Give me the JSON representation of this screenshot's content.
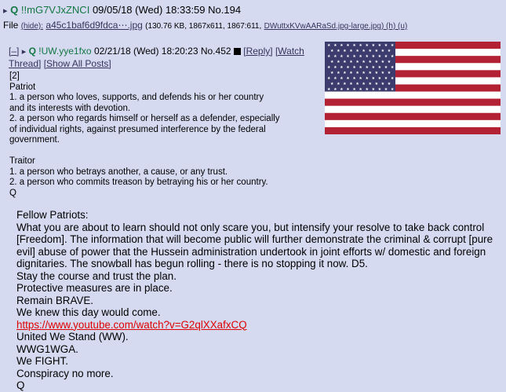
{
  "post": {
    "prefix": "▸",
    "name": "Q",
    "trip": "!!mG7VJxZNCI",
    "date": "09/05/18 (Wed) 18:33:59",
    "number": "No.194",
    "file_label": "File",
    "file_hide": "(hide):",
    "file_name": "a45c1baf6d9fdca⋯.jpg",
    "file_info": "(130.76 KB, 1867x611, 1867:611,",
    "file_source": "DWuttxKVwAARaSd.jpg-large.jpg",
    "file_links": ") (h) (u)"
  },
  "quoted": {
    "controls": "[–]",
    "name": "Q",
    "trip": "!UW.yye1fxo",
    "date": "02/21/18 (Wed) 18:20:23",
    "number": "No.452",
    "reply": "[Reply]",
    "watch": "[Watch",
    "thread": "Thread]",
    "show_all": "[Show All Posts]",
    "lines": [
      "[2]",
      "Patriot",
      "1. a person who loves, supports, and defends his or her country",
      "and its interests with devotion.",
      "2. a person who regards himself or herself as a defender, especially",
      "of individual rights, against presumed interference by the federal",
      "government.",
      "",
      "Traitor",
      "1. a person who betrays another, a cause, or any trust.",
      "2. a person who commits treason by betraying his or her country.",
      "Q"
    ]
  },
  "message": {
    "lines": [
      "Fellow Patriots:",
      "What you are about to learn should not only scare you, but intensify your resolve to take back control",
      "[Freedom]. The information that will become public will further demonstrate the criminal & corrupt [pure",
      "evil] abuse of power that the Hussein administration undertook in joint efforts w/ domestic and foreign",
      "dignitaries. The snowball has begun rolling - there is no stopping it now. D5.",
      "Stay the course and trust the plan.",
      "Protective measures are in place.",
      "Remain BRAVE.",
      "We knew this day would come."
    ],
    "link": "https://www.youtube.com/watch?v=G2qlXXafxCQ",
    "closing": [
      "United We Stand (WW).",
      "WWG1WGA.",
      "We FIGHT.",
      "Conspiracy no more.",
      "Q"
    ]
  },
  "colors": {
    "background": "#d6daf0",
    "name": "#117743",
    "link": "#34345c",
    "url": "#dd0000",
    "flag_red": "#b22234",
    "flag_blue": "#3c3b6e"
  }
}
